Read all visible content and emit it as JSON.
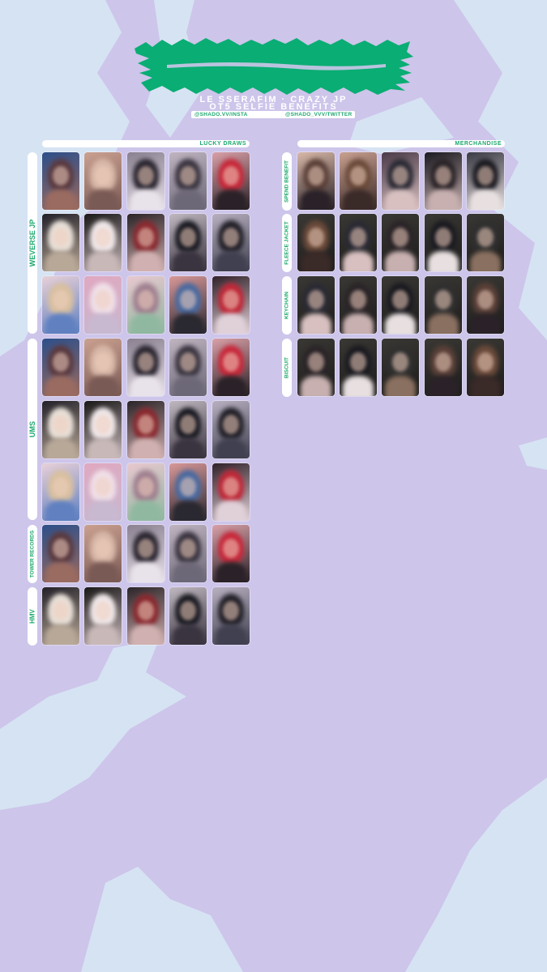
{
  "header": {
    "title_line1": "LE SSERAFIM · CRAZY JP",
    "title_line2": "OT5 SELFIE BENEFITS",
    "insta_handle": "@SHADO.VV/INSTA",
    "twitter_handle": "@SHADO_VVV/TWITTER"
  },
  "lucky_draws": {
    "label": "LUCKY DRAWS",
    "groups": [
      {
        "label": "WEVERSE JP",
        "rows": 3
      },
      {
        "label": "UMS",
        "rows": 3
      },
      {
        "label": "TOWER RECORDS",
        "rows": 1
      },
      {
        "label": "HMV",
        "rows": 1
      }
    ]
  },
  "merchandise": {
    "label": "MERCHANDISE",
    "groups": [
      {
        "label": "SPEND BENEFIT",
        "rows": 1
      },
      {
        "label": "FLEECE JACKET",
        "rows": 1
      },
      {
        "label": "KEYCHAIN",
        "rows": 1
      },
      {
        "label": "BISCUIT",
        "rows": 1
      }
    ]
  },
  "colors": {
    "background": "#cdc5ea",
    "brush_strokes": "#d7e4f4",
    "accent_green": "#1ea96e",
    "label_bg": "#ffffff"
  },
  "icons": {
    "logo": "green-brush-stroke-logo",
    "photocards": "blurred-selfie-photocard"
  }
}
